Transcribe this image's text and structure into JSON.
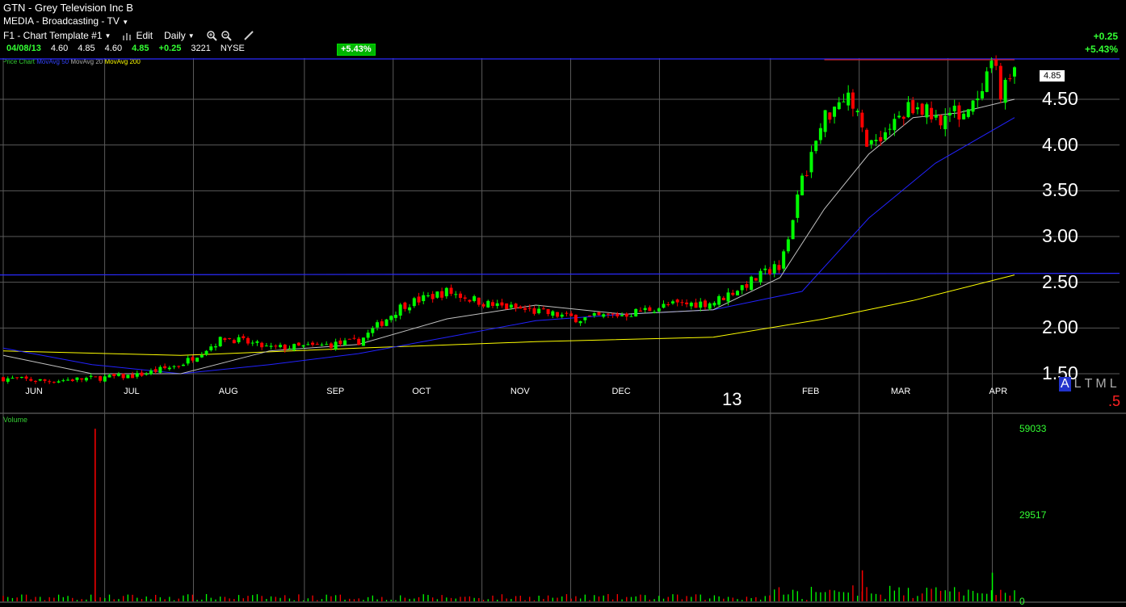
{
  "header": {
    "title": "GTN  - Grey Television Inc B",
    "sector": "MEDIA - Broadcasting - TV",
    "template_label": "F1 - Chart Template #1",
    "edit_label": "Edit",
    "period_label": "Daily",
    "change_abs": "+0.25",
    "change_pct": "+5.43%"
  },
  "quote": {
    "date": "04/08/13",
    "open": "4.60",
    "high": "4.85",
    "low": "4.60",
    "close": "4.85",
    "change": "+0.25",
    "volume": "3221",
    "exchange": "NYSE",
    "pct_badge": "+5.43%"
  },
  "legend": {
    "price_chart": "Price Chart",
    "ma50": "MovAvg 50",
    "ma20": "MovAvg 20",
    "ma200": "MovAvg 200"
  },
  "last_price_label": "4.85",
  "year_label": "13",
  "timeframe_buttons": [
    "A",
    "L",
    "T",
    "M",
    "L"
  ],
  "scale_note": ".5",
  "volume_title": "Volume",
  "colors": {
    "up": "#00ff00",
    "down": "#ff0000",
    "ma20": "#c0c0c0",
    "ma50": "#2222ff",
    "ma200": "#ffff00",
    "grid": "#5a5a5a"
  },
  "chart_data": [
    {
      "type": "line",
      "title": "GTN - Grey Television Inc B",
      "y_ticks": [
        "4.50",
        "4.00",
        "3.50",
        "3.00",
        "2.50",
        "2.00",
        "1.50"
      ],
      "ylim": [
        1.35,
        4.95
      ],
      "x_ticks": [
        "JUN",
        "JUL",
        "AUG",
        "SEP",
        "OCT",
        "NOV",
        "DEC",
        "FEB",
        "MAR",
        "APR"
      ],
      "grid": true,
      "series": [
        {
          "name": "Price Chart",
          "x": [
            "2012-05-24",
            "2012-06-07",
            "2012-06-21",
            "2012-07-05",
            "2012-07-19",
            "2012-08-02",
            "2012-08-16",
            "2012-08-30",
            "2012-09-13",
            "2012-09-27",
            "2012-10-11",
            "2012-10-25",
            "2012-11-08",
            "2012-11-22",
            "2012-12-06",
            "2012-12-20",
            "2013-01-03",
            "2013-01-17",
            "2013-01-24",
            "2013-01-31",
            "2013-02-07",
            "2013-02-14",
            "2013-02-21",
            "2013-02-28",
            "2013-03-07",
            "2013-03-14",
            "2013-03-21",
            "2013-03-28",
            "2013-04-01",
            "2013-04-04",
            "2013-04-08"
          ],
          "values": [
            1.45,
            1.42,
            1.45,
            1.48,
            1.6,
            1.9,
            1.78,
            1.8,
            1.85,
            2.25,
            2.4,
            2.25,
            2.18,
            2.1,
            2.15,
            2.25,
            2.28,
            2.55,
            2.7,
            3.6,
            4.3,
            4.6,
            4.0,
            4.2,
            4.45,
            4.3,
            4.35,
            4.45,
            4.9,
            4.55,
            4.85
          ]
        },
        {
          "name": "MovAvg 20",
          "x": [
            "2012-05-24",
            "2012-06-21",
            "2012-07-19",
            "2012-08-16",
            "2012-09-13",
            "2012-10-11",
            "2012-11-08",
            "2012-12-06",
            "2013-01-03",
            "2013-01-24",
            "2013-02-07",
            "2013-02-21",
            "2013-03-07",
            "2013-03-21",
            "2013-04-08"
          ],
          "values": [
            1.7,
            1.5,
            1.5,
            1.75,
            1.82,
            2.1,
            2.25,
            2.15,
            2.2,
            2.55,
            3.3,
            3.9,
            4.3,
            4.35,
            4.5
          ]
        },
        {
          "name": "MovAvg 50",
          "x": [
            "2012-05-24",
            "2012-06-21",
            "2012-07-19",
            "2012-08-16",
            "2012-09-13",
            "2012-10-11",
            "2012-11-08",
            "2012-12-06",
            "2013-01-03",
            "2013-01-31",
            "2013-02-21",
            "2013-03-14",
            "2013-04-08"
          ],
          "values": [
            1.78,
            1.6,
            1.5,
            1.6,
            1.72,
            1.9,
            2.08,
            2.15,
            2.2,
            2.4,
            3.2,
            3.8,
            4.3
          ]
        },
        {
          "name": "MovAvg 200",
          "x": [
            "2012-05-24",
            "2012-07-19",
            "2012-09-13",
            "2012-11-08",
            "2013-01-03",
            "2013-02-07",
            "2013-03-07",
            "2013-04-08"
          ],
          "values": [
            1.75,
            1.7,
            1.78,
            1.85,
            1.9,
            2.1,
            2.3,
            2.58
          ]
        }
      ]
    },
    {
      "type": "bar",
      "title": "Volume",
      "y_ticks": [
        "59033",
        "29517",
        "0"
      ],
      "ylim": [
        0,
        59033
      ],
      "spikes": [
        {
          "x": "2012-06-22",
          "value": 59000,
          "color": "red"
        },
        {
          "x": "2013-02-19",
          "value": 10600,
          "color": "red"
        },
        {
          "x": "2013-04-01",
          "value": 9800,
          "color": "green"
        }
      ]
    }
  ]
}
